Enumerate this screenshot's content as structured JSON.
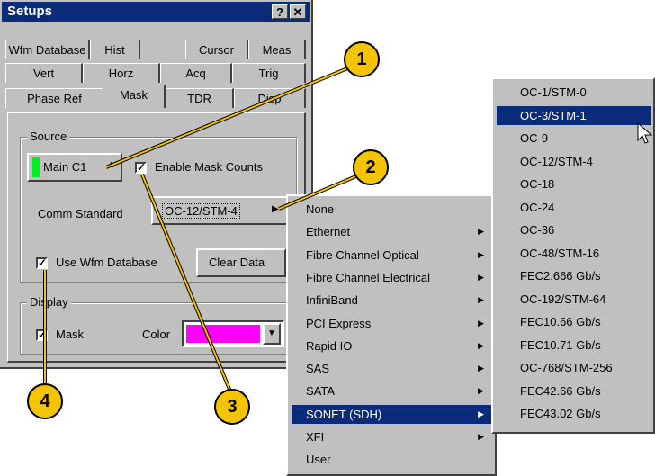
{
  "dialog": {
    "title": "Setups",
    "help_btn": "?",
    "close_btn": "✕",
    "tabs_row1": [
      "Wfm Database",
      "Hist",
      "Cursor",
      "Meas"
    ],
    "tabs_row2": [
      "Vert",
      "Horz",
      "Acq",
      "Trig"
    ],
    "tabs_row3": [
      "Phase Ref",
      "Mask",
      "TDR",
      "Disp"
    ],
    "selected_tab": "Mask",
    "source_group_label": "Source",
    "source_button": "Main C1",
    "enable_mask_counts": "Enable Mask Counts",
    "comm_standard_label": "Comm Standard",
    "comm_standard_value": "OC-12/STM-4",
    "use_wfm_database": "Use Wfm Database",
    "clear_data": "Clear Data",
    "display_group_label": "Display",
    "mask_checkbox": "Mask",
    "color_label": "Color",
    "color_value": "#ff00ff",
    "source_indicator_color": "#00ee22"
  },
  "menu1": {
    "items": [
      "None",
      "Ethernet",
      "Fibre Channel Optical",
      "Fibre Channel Electrical",
      "InfiniBand",
      "PCI Express",
      "Rapid IO",
      "SAS",
      "SATA",
      "SONET (SDH)",
      "XFI",
      "User"
    ],
    "submenu_flags": [
      false,
      true,
      true,
      true,
      true,
      true,
      true,
      true,
      true,
      true,
      true,
      false
    ],
    "highlighted": "SONET (SDH)"
  },
  "menu2": {
    "items": [
      "OC-1/STM-0",
      "OC-3/STM-1",
      "OC-9",
      "OC-12/STM-4",
      "OC-18",
      "OC-24",
      "OC-36",
      "OC-48/STM-16",
      "FEC2.666 Gb/s",
      "OC-192/STM-64",
      "FEC10.66 Gb/s",
      "FEC10.71 Gb/s",
      "OC-768/STM-256",
      "FEC42.66 Gb/s",
      "FEC43.02 Gb/s"
    ],
    "highlighted": "OC-3/STM-1"
  },
  "callouts": [
    "1",
    "2",
    "3",
    "4"
  ],
  "colors": {
    "callout": "#f5c400",
    "highlight": "#0a2a7a",
    "face": "#c0c0c0"
  }
}
